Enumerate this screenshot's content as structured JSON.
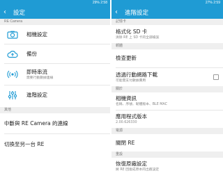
{
  "status_left": {
    "text": "29% 2:58"
  },
  "status_right": {
    "text": "27% 2:59"
  },
  "left": {
    "title": "設定",
    "section_recam": "RE Camera",
    "items": [
      {
        "icon": "camera-settings-icon",
        "label": "相機設定"
      },
      {
        "icon": "backup-icon",
        "label": "備份"
      },
      {
        "icon": "livestream-icon",
        "label": "即時串流",
        "sub": "需要行動數據連線"
      },
      {
        "icon": "sliders-icon",
        "label": "進階設定"
      }
    ],
    "section_other": "其他",
    "disconnect": "中斷與 RE Camera 的連線",
    "switch": "切換至另一台 RE"
  },
  "right": {
    "title": "進階設定",
    "section_sd": "記憶卡",
    "format_label": "格式化 SD 卡",
    "format_sub": "清除 RE 上 SD 卡的全部檔案",
    "section_firmware": "韌體",
    "update_label": "檢查更新",
    "mobile_label": "透過行動網路下載",
    "mobile_sub": "可能需支付數據費用",
    "section_about": "關於",
    "caminfo_label": "相機資訊",
    "caminfo_sub": "名稱、序號、韌體版本、BLE MAC",
    "appver_label": "應用程式版本",
    "appver_sub": "2.00.626330",
    "section_power": "電源",
    "poweroff_label": "關閉 RE",
    "section_reset": "重設",
    "restore_label": "恢復原廠設定",
    "restore_sub": "將 RE 回復成原本的出廠設定"
  },
  "colors": {
    "accent": "#1f9bd4",
    "icon_blue": "#1f9bd4"
  }
}
